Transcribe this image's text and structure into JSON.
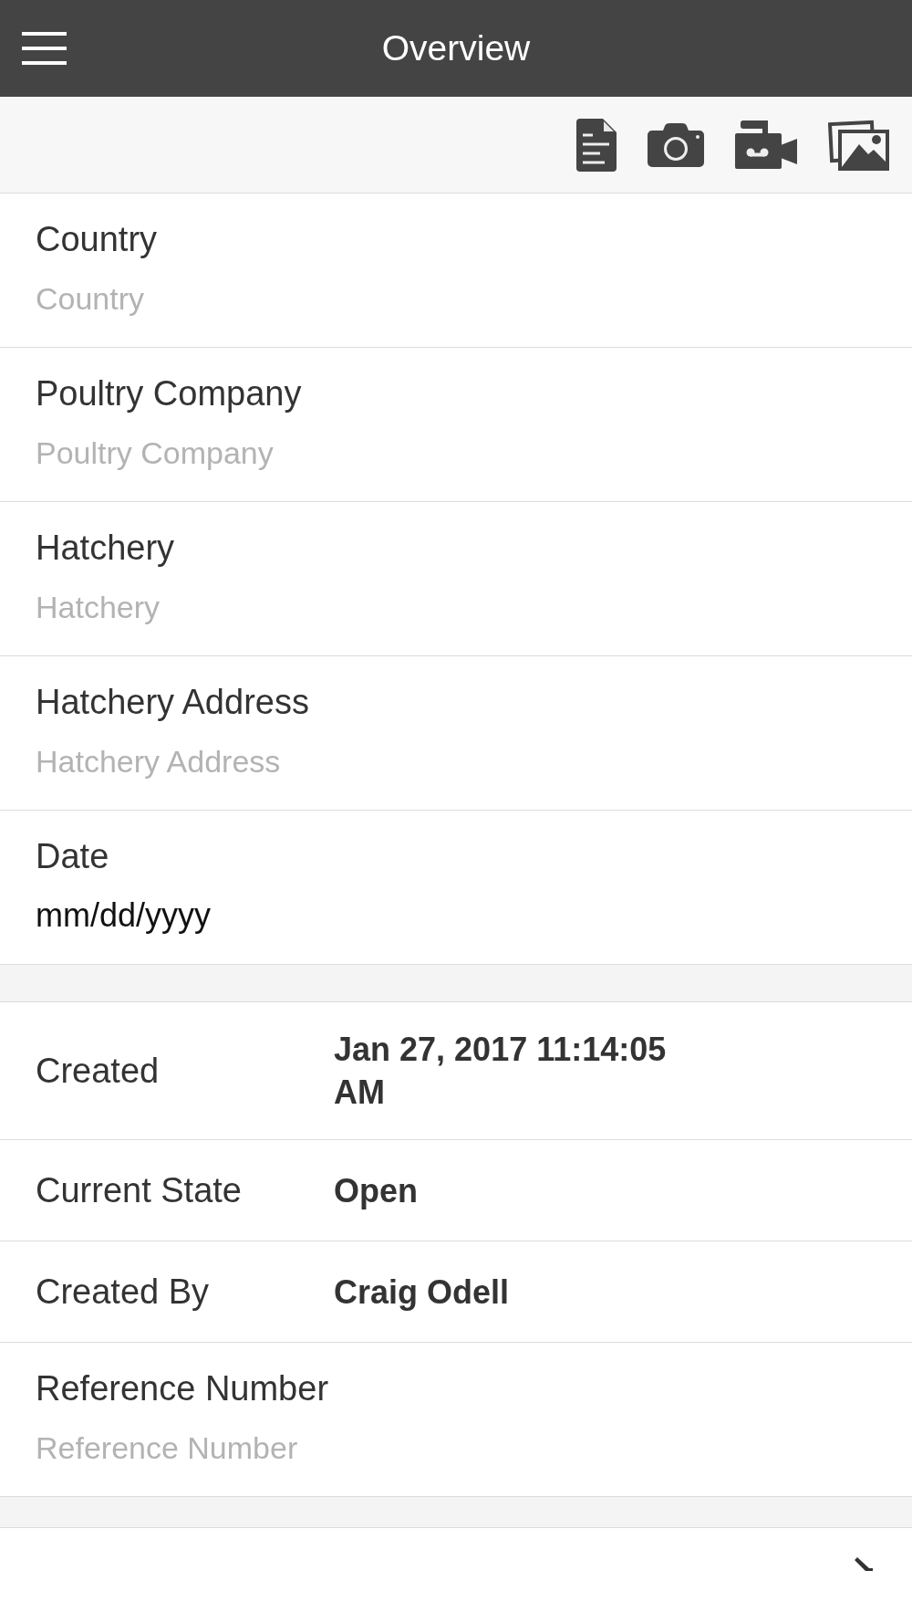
{
  "header": {
    "title": "Overview"
  },
  "fields": [
    {
      "kind": "text",
      "label": "Country",
      "placeholder": "Country"
    },
    {
      "kind": "text",
      "label": "Poultry Company",
      "placeholder": "Poultry Company"
    },
    {
      "kind": "text",
      "label": "Hatchery",
      "placeholder": "Hatchery"
    },
    {
      "kind": "text",
      "label": "Hatchery Address",
      "placeholder": "Hatchery Address"
    },
    {
      "kind": "date",
      "label": "Date",
      "placeholder": "mm/dd/yyyy"
    }
  ],
  "details": [
    {
      "label": "Created",
      "value": "Jan 27, 2017 11:14:05 AM"
    },
    {
      "label": "Current State",
      "value": "Open"
    },
    {
      "label": "Created By",
      "value": "Craig Odell"
    }
  ],
  "extra_fields": [
    {
      "kind": "text",
      "label": "Reference Number",
      "placeholder": "Reference Number"
    }
  ]
}
